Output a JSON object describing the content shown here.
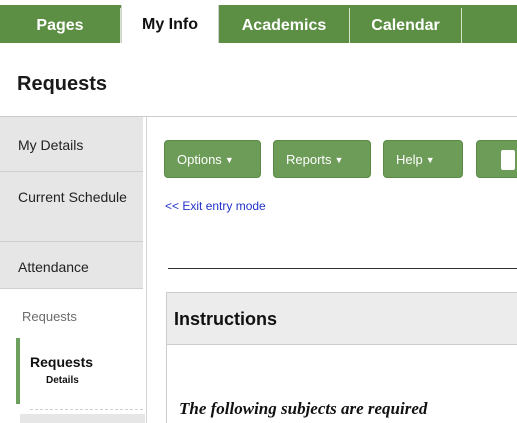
{
  "nav": {
    "tabs": [
      {
        "label": "Pages"
      },
      {
        "label": "My Info"
      },
      {
        "label": "Academics"
      },
      {
        "label": "Calendar"
      }
    ]
  },
  "header": {
    "title": "Requests"
  },
  "sidebar": {
    "items": [
      {
        "label": "My Details"
      },
      {
        "label": "Current Schedule"
      },
      {
        "label": "Attendance"
      }
    ],
    "section_label": "Requests",
    "active": {
      "label": "Requests",
      "sub": "Details"
    }
  },
  "toolbar": {
    "options_label": "Options",
    "reports_label": "Reports",
    "help_label": "Help",
    "caret_icon": "caret-down-icon"
  },
  "main": {
    "exit_link": "<< Exit entry mode",
    "instructions": {
      "title": "Instructions",
      "text": "The following subjects are required"
    }
  },
  "colors": {
    "nav_green": "#5c8f44",
    "button_green": "#6d9c58",
    "link_blue": "#2233cc",
    "active_marker": "#6da05c"
  }
}
